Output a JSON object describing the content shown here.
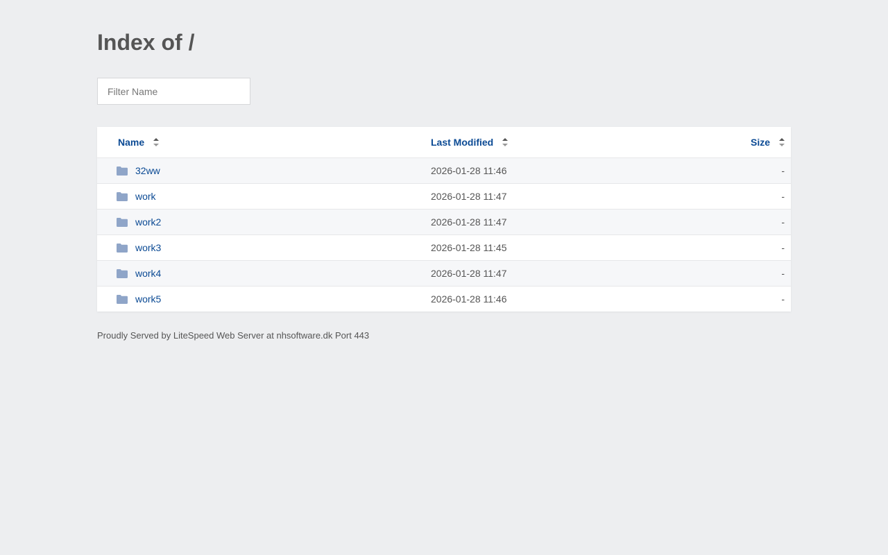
{
  "page": {
    "title": "Index of /",
    "filter_placeholder": "Filter Name",
    "footer": "Proudly Served by LiteSpeed Web Server at nhsoftware.dk Port 443"
  },
  "table": {
    "headers": {
      "name": "Name",
      "modified": "Last Modified",
      "size": "Size"
    },
    "rows": [
      {
        "name": "32ww",
        "modified": "2026-01-28 11:46",
        "size": "-"
      },
      {
        "name": "work",
        "modified": "2026-01-28 11:47",
        "size": "-"
      },
      {
        "name": "work2",
        "modified": "2026-01-28 11:47",
        "size": "-"
      },
      {
        "name": "work3",
        "modified": "2026-01-28 11:45",
        "size": "-"
      },
      {
        "name": "work4",
        "modified": "2026-01-28 11:47",
        "size": "-"
      },
      {
        "name": "work5",
        "modified": "2026-01-28 11:46",
        "size": "-"
      }
    ]
  },
  "colors": {
    "background": "#edeef0",
    "link": "#0b4a94",
    "folder_icon": "#8fa5c8"
  },
  "icons": {
    "row_icon": "folder-icon",
    "sort_icon": "sort-icon"
  }
}
